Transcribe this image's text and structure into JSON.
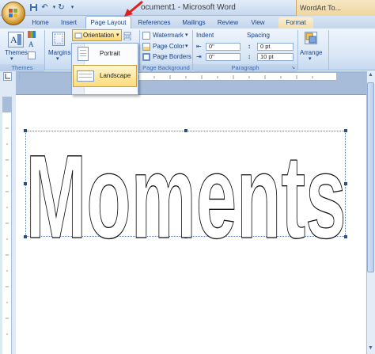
{
  "window": {
    "doc_title": "ocument1 - Microsoft Word",
    "context_title": "WordArt To..."
  },
  "tabs": [
    "Home",
    "Insert",
    "Page Layout",
    "References",
    "Mailings",
    "Review",
    "View",
    "Format"
  ],
  "active_tab": "Page Layout",
  "ribbon": {
    "themes": {
      "button_label": "Themes",
      "group_label": "Themes"
    },
    "page_setup": {
      "margins_label": "Margins",
      "orientation_label": "Orientation"
    },
    "page_background": {
      "group_label": "Page Background",
      "watermark_label": "Watermark",
      "page_color_label": "Page Color",
      "page_borders_label": "Page Borders"
    },
    "paragraph": {
      "group_label": "Paragraph",
      "indent_label": "Indent",
      "spacing_label": "Spacing",
      "indent_left_value": "0\"",
      "indent_right_value": "0\"",
      "spacing_before_value": "0 pt",
      "spacing_after_value": "10 pt"
    },
    "arrange": {
      "button_label": "Arrange"
    }
  },
  "orientation_menu": {
    "items": [
      "Portrait",
      "Landscape"
    ],
    "selected": "Landscape"
  },
  "document": {
    "wordart_text": "Moments"
  },
  "colors": {
    "ribbon_text": "#15428b",
    "highlight": "#ffd86e",
    "arrow": "#e0201c"
  }
}
